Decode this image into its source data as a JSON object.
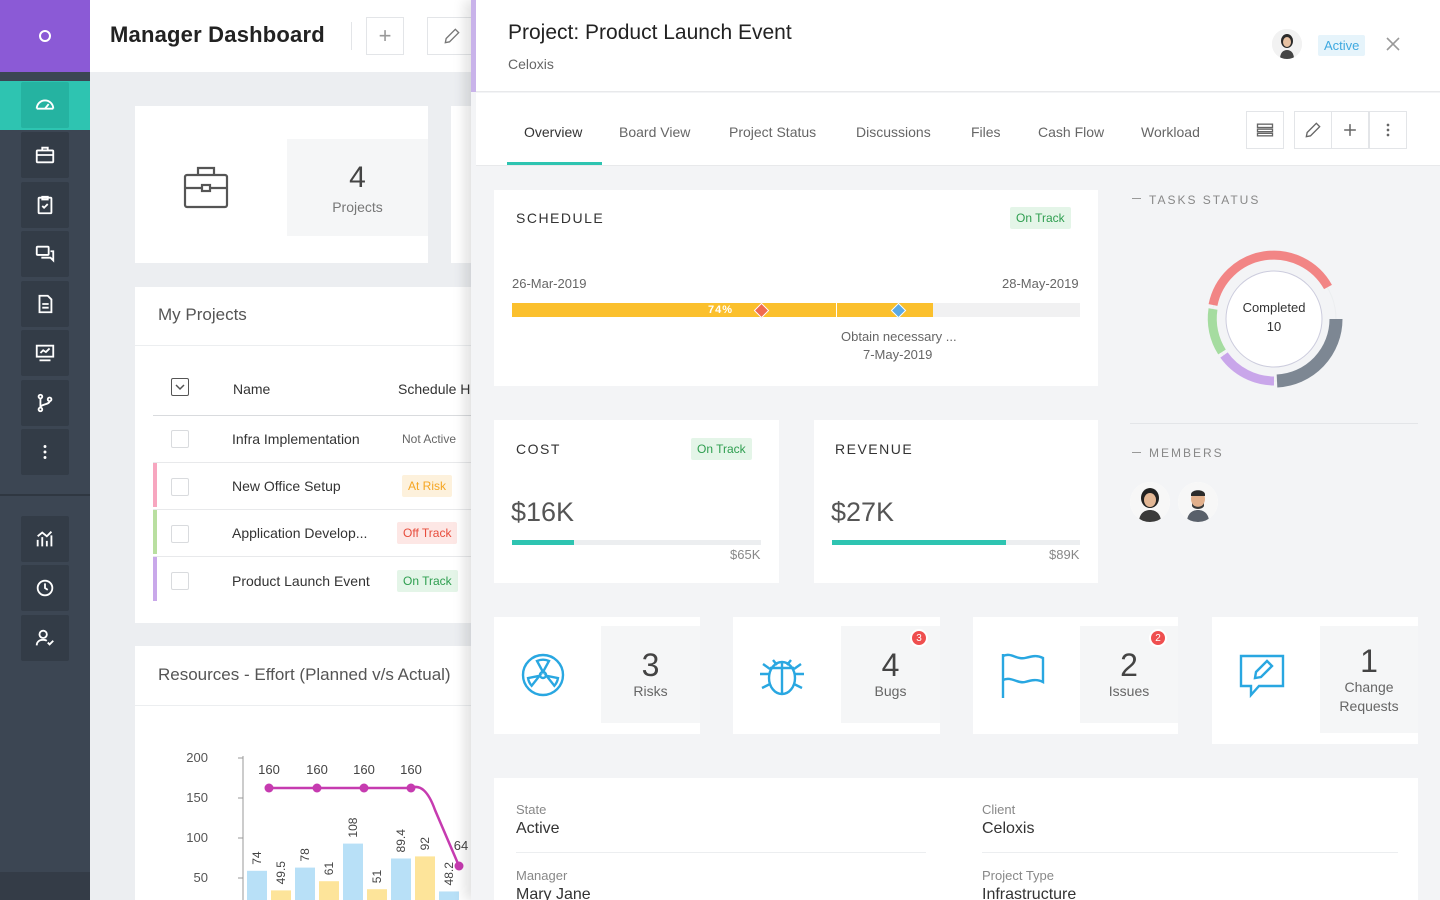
{
  "dashboard": {
    "title": "Manager Dashboard",
    "stat": {
      "value": "4",
      "label": "Projects"
    },
    "my_projects": {
      "title": "My Projects",
      "columns": [
        "Name",
        "Schedule H"
      ],
      "rows": [
        {
          "name": "Infra Implementation",
          "status": "Not Active"
        },
        {
          "name": "New Office Setup",
          "status": "At Risk"
        },
        {
          "name": "Application Develop...",
          "status": "Off Track"
        },
        {
          "name": "Product Launch Event",
          "status": "On Track"
        }
      ]
    },
    "resources": {
      "title": "Resources - Effort (Planned v/s Actual)",
      "chart_data": {
        "type": "bar",
        "y_ticks": [
          "200",
          "150",
          "100",
          "50"
        ],
        "ylim": [
          0,
          200
        ],
        "line_values": [
          160,
          160,
          160,
          160
        ],
        "line_labels": [
          "160",
          "160",
          "160",
          "160",
          "64"
        ],
        "bar_labels": [
          "74",
          "49.5",
          "78",
          "61",
          "108",
          "51",
          "89.4",
          "92",
          "48.2"
        ],
        "bars": [
          74,
          49.5,
          78,
          61,
          108,
          51,
          89.4,
          92,
          48.2
        ]
      }
    }
  },
  "panel": {
    "title": "Project: Product Launch Event",
    "subtitle": "Celoxis",
    "status_badge": "Active",
    "tabs": [
      "Overview",
      "Board View",
      "Project Status",
      "Discussions",
      "Files",
      "Cash Flow",
      "Workload"
    ],
    "schedule": {
      "heading": "SCHEDULE",
      "status": "On Track",
      "start": "26-Mar-2019",
      "end": "28-May-2019",
      "progress_label": "74%",
      "progress": 0.74,
      "milestone_name": "Obtain necessary ...",
      "milestone_date": "7-May-2019"
    },
    "cost": {
      "heading": "COST",
      "status": "On Track",
      "amount": "$16K",
      "budget": "$65K",
      "fraction": 0.25
    },
    "revenue": {
      "heading": "REVENUE",
      "amount": "$27K",
      "target": "$89K",
      "fraction": 0.7
    },
    "tasks_status": {
      "heading": "TASKS STATUS",
      "center_label": "Completed",
      "center_value": "10"
    },
    "members": {
      "heading": "MEMBERS"
    },
    "metrics": [
      {
        "value": "3",
        "label": "Risks",
        "badge": ""
      },
      {
        "value": "4",
        "label": "Bugs",
        "badge": "3"
      },
      {
        "value": "2",
        "label": "Issues",
        "badge": "2"
      },
      {
        "value": "1",
        "label": "Change Requests",
        "label_line1": "Change",
        "label_line2": "Requests",
        "badge": ""
      }
    ],
    "details": {
      "state_label": "State",
      "state_value": "Active",
      "client_label": "Client",
      "client_value": "Celoxis",
      "manager_label": "Manager",
      "manager_value": "Mary Jane",
      "type_label": "Project Type",
      "type_value": "Infrastructure"
    }
  },
  "colors": {
    "brand_purple": "#8b5ad6",
    "accent_teal": "#2ec4b1",
    "schedule_yellow": "#fbc02d",
    "nav_dark": "#3c4653"
  }
}
